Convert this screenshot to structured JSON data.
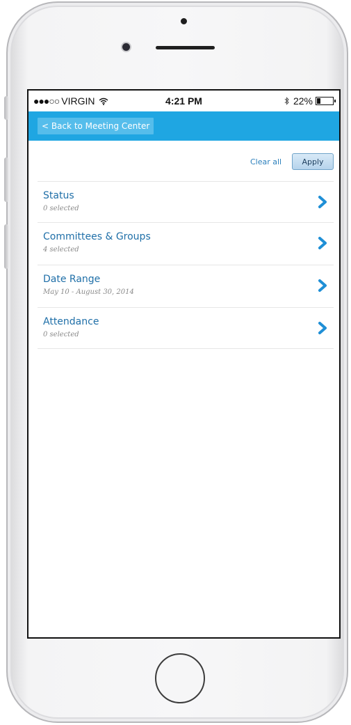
{
  "status_bar": {
    "signal": "●●●○○",
    "carrier": "VIRGIN",
    "wifi_icon": "wifi-icon",
    "time": "4:21 PM",
    "bluetooth_icon": "bluetooth-icon",
    "battery_percent": "22%",
    "battery_level": 0.22
  },
  "nav": {
    "back_label": "< Back to Meeting Center"
  },
  "actions": {
    "clear_all": "Clear all",
    "apply": "Apply"
  },
  "filters": [
    {
      "title": "Status",
      "subtitle": "0 selected"
    },
    {
      "title": "Committees & Groups",
      "subtitle": "4 selected"
    },
    {
      "title": "Date Range",
      "subtitle": "May 10 - August 30, 2014"
    },
    {
      "title": "Attendance",
      "subtitle": "0 selected"
    }
  ],
  "colors": {
    "nav_bar": "#1fa6e2",
    "link": "#1f6fa8",
    "chevron": "#1f8fd6"
  }
}
